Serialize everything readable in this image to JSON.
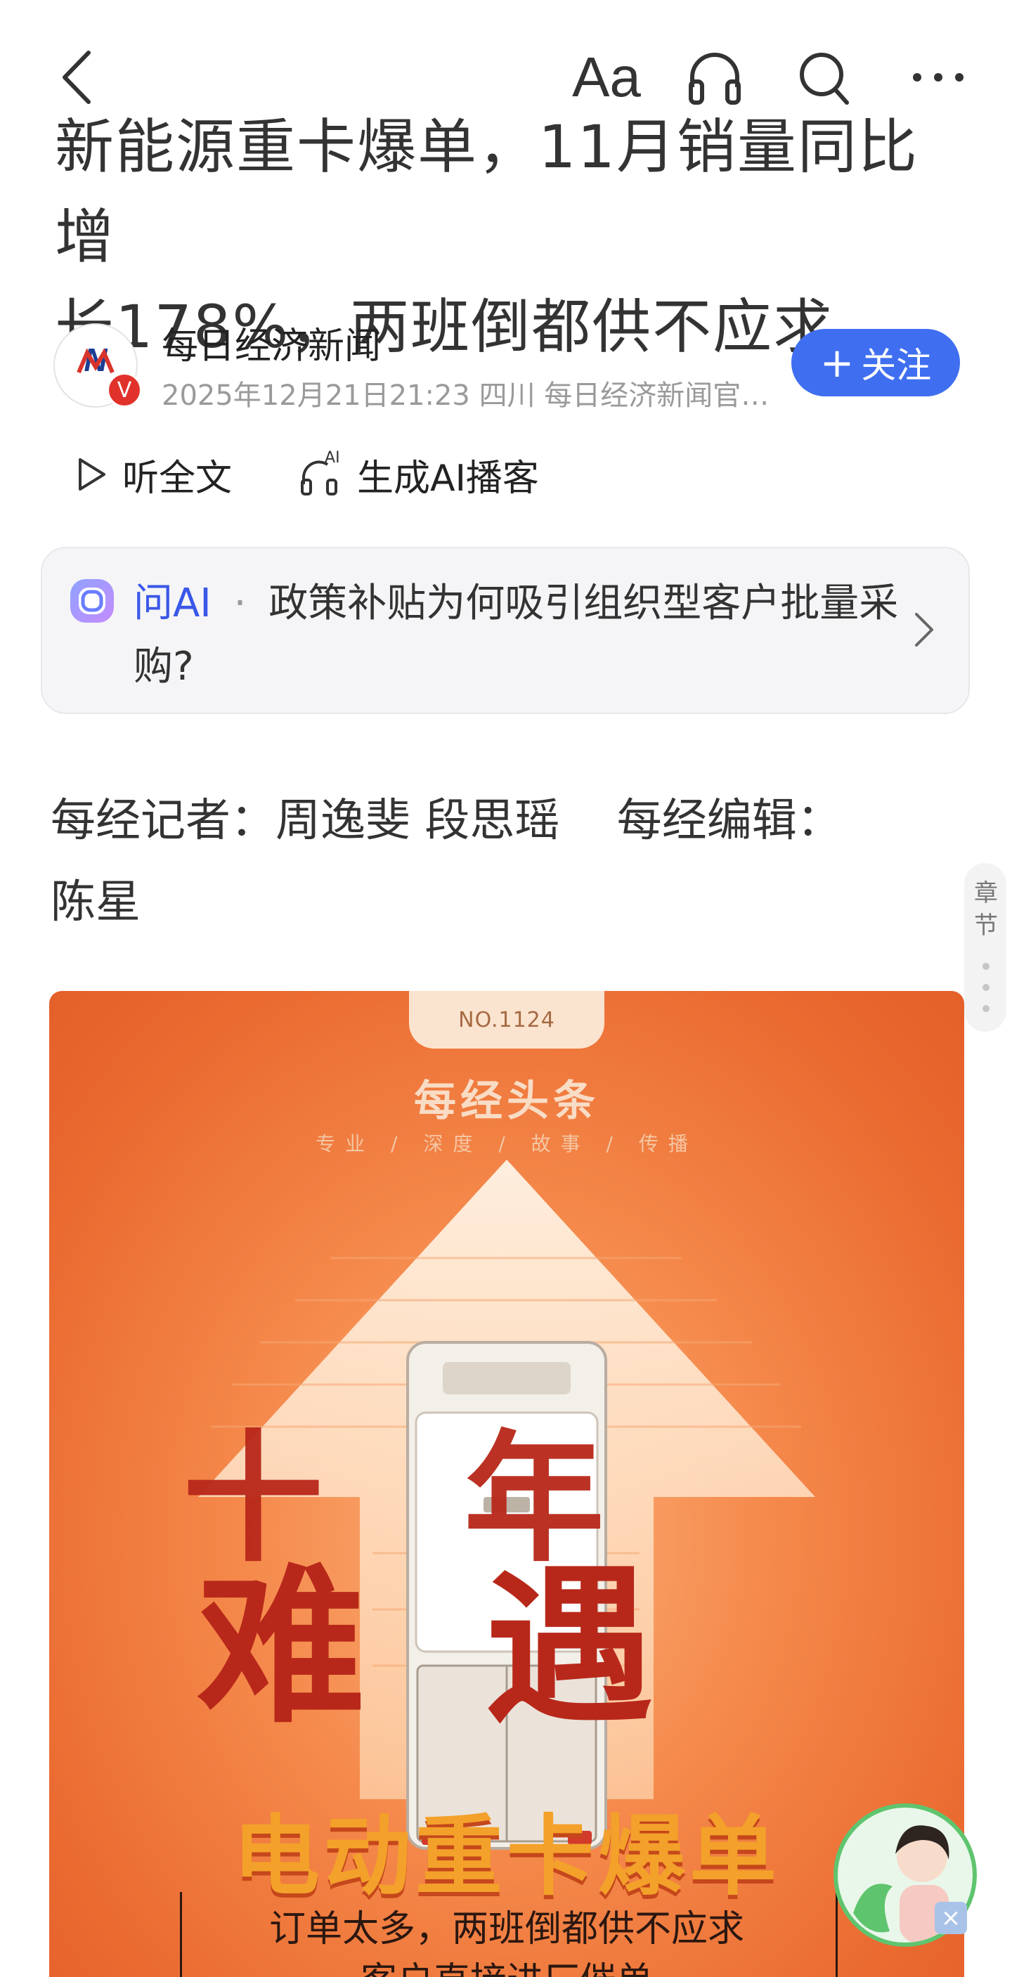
{
  "header": {
    "back_icon": "back-chevron-icon",
    "font_size_label": "Aa",
    "headphones_icon": "headphones-icon",
    "search_icon": "search-icon",
    "more_icon": "more-icon"
  },
  "article": {
    "title_line1": "新能源重卡爆单，11月销量同比增",
    "title_line2": "长178%，两班倒都供不应求"
  },
  "author": {
    "name": "每日经济新闻",
    "meta": "2025年12月21日21:23 四川 每日经济新闻官…",
    "avatar_badge": "V",
    "follow_label": "关注",
    "follow_plus": "+"
  },
  "listen": {
    "listen_label": "听全文",
    "podcast_label": "生成AI播客",
    "podcast_badge": "AI"
  },
  "ask_ai": {
    "label": "问AI",
    "separator": "·",
    "question": "政策补贴为何吸引组织型客户批量采购?"
  },
  "byline": {
    "line1": "每经记者：周逸斐 段思瑶    每经编辑：",
    "line2": "陈星"
  },
  "chapter": {
    "label_1": "章",
    "label_2": "节"
  },
  "poster": {
    "number": "NO.1124",
    "brand": "每经头条",
    "tagline": "专业 / 深度 / 故事 / 传播",
    "big_chars_1": "十年",
    "big_chars_2": "难遇",
    "headline": "电动重卡爆单",
    "subline_1": "订单太多，两班倒都供不应求",
    "subline_2": "客户直接进厂催单"
  },
  "colors": {
    "accent_blue": "#3f6ff0",
    "ai_blue": "#3a57e8",
    "poster_orange": "#ea6a30",
    "poster_red": "#b8281a",
    "mascot_green": "#5fc46e"
  }
}
